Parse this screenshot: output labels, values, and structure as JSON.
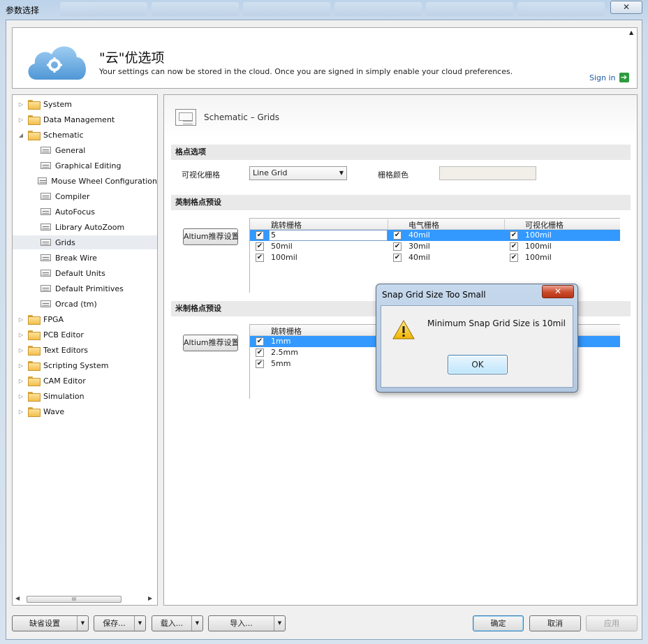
{
  "window": {
    "title": "参数选择",
    "close": "✕"
  },
  "banner": {
    "title": "\"云\"优选项",
    "subtitle": "Your settings can now be stored in the cloud. Once you are signed in simply enable your cloud preferences.",
    "sign_in": "Sign in",
    "collapse": "▲"
  },
  "tree": {
    "items": [
      {
        "label": "System",
        "type": "folder",
        "exp": "▷"
      },
      {
        "label": "Data Management",
        "type": "folder",
        "exp": "▷"
      },
      {
        "label": "Schematic",
        "type": "folder-open",
        "exp": "◢"
      },
      {
        "label": "General",
        "type": "page"
      },
      {
        "label": "Graphical Editing",
        "type": "page"
      },
      {
        "label": "Mouse Wheel Configuration",
        "type": "page"
      },
      {
        "label": "Compiler",
        "type": "page"
      },
      {
        "label": "AutoFocus",
        "type": "page"
      },
      {
        "label": "Library AutoZoom",
        "type": "page"
      },
      {
        "label": "Grids",
        "type": "page",
        "selected": true
      },
      {
        "label": "Break Wire",
        "type": "page"
      },
      {
        "label": "Default Units",
        "type": "page"
      },
      {
        "label": "Default Primitives",
        "type": "page"
      },
      {
        "label": "Orcad (tm)",
        "type": "page"
      },
      {
        "label": "FPGA",
        "type": "folder",
        "exp": "▷"
      },
      {
        "label": "PCB Editor",
        "type": "folder",
        "exp": "▷"
      },
      {
        "label": "Text Editors",
        "type": "folder",
        "exp": "▷"
      },
      {
        "label": "Scripting System",
        "type": "folder",
        "exp": "▷"
      },
      {
        "label": "CAM Editor",
        "type": "folder",
        "exp": "▷"
      },
      {
        "label": "Simulation",
        "type": "folder",
        "exp": "▷"
      },
      {
        "label": "Wave",
        "type": "folder",
        "exp": "▷"
      }
    ],
    "scroll_left": "◀",
    "scroll_right": "▶",
    "scroll_grip": "III"
  },
  "panel": {
    "title": "Schematic – Grids",
    "grid_options": {
      "section": "格点选项",
      "visible_grid_label": "可视化栅格",
      "visible_grid_value": "Line Grid",
      "grid_color_label": "栅格颜色"
    },
    "imperial": {
      "section": "英制格点预设",
      "button": "Altium推荐设置",
      "headers": [
        "跳转栅格",
        "电气栅格",
        "可视化栅格"
      ],
      "rows": [
        {
          "snap": "5",
          "elec": "40mil",
          "visible": "100mil",
          "selected": true
        },
        {
          "snap": "50mil",
          "elec": "30mil",
          "visible": "100mil"
        },
        {
          "snap": "100mil",
          "elec": "40mil",
          "visible": "100mil"
        }
      ]
    },
    "metric": {
      "section": "米制格点预设",
      "button": "Altium推荐设置",
      "headers": [
        "跳转栅格"
      ],
      "rows": [
        {
          "snap": "1mm",
          "selected": true
        },
        {
          "snap": "2.5mm"
        },
        {
          "snap": "5mm"
        }
      ]
    }
  },
  "buttons": {
    "defaults": "缺省设置",
    "save": "保存...",
    "load": "载入...",
    "import": "导入...",
    "ok": "确定",
    "cancel": "取消",
    "apply": "应用",
    "dropdown": "▼"
  },
  "dialog": {
    "title": "Snap Grid Size Too Small",
    "close": "✕",
    "message": "Minimum Snap Grid Size is 10mil",
    "ok": "OK"
  }
}
